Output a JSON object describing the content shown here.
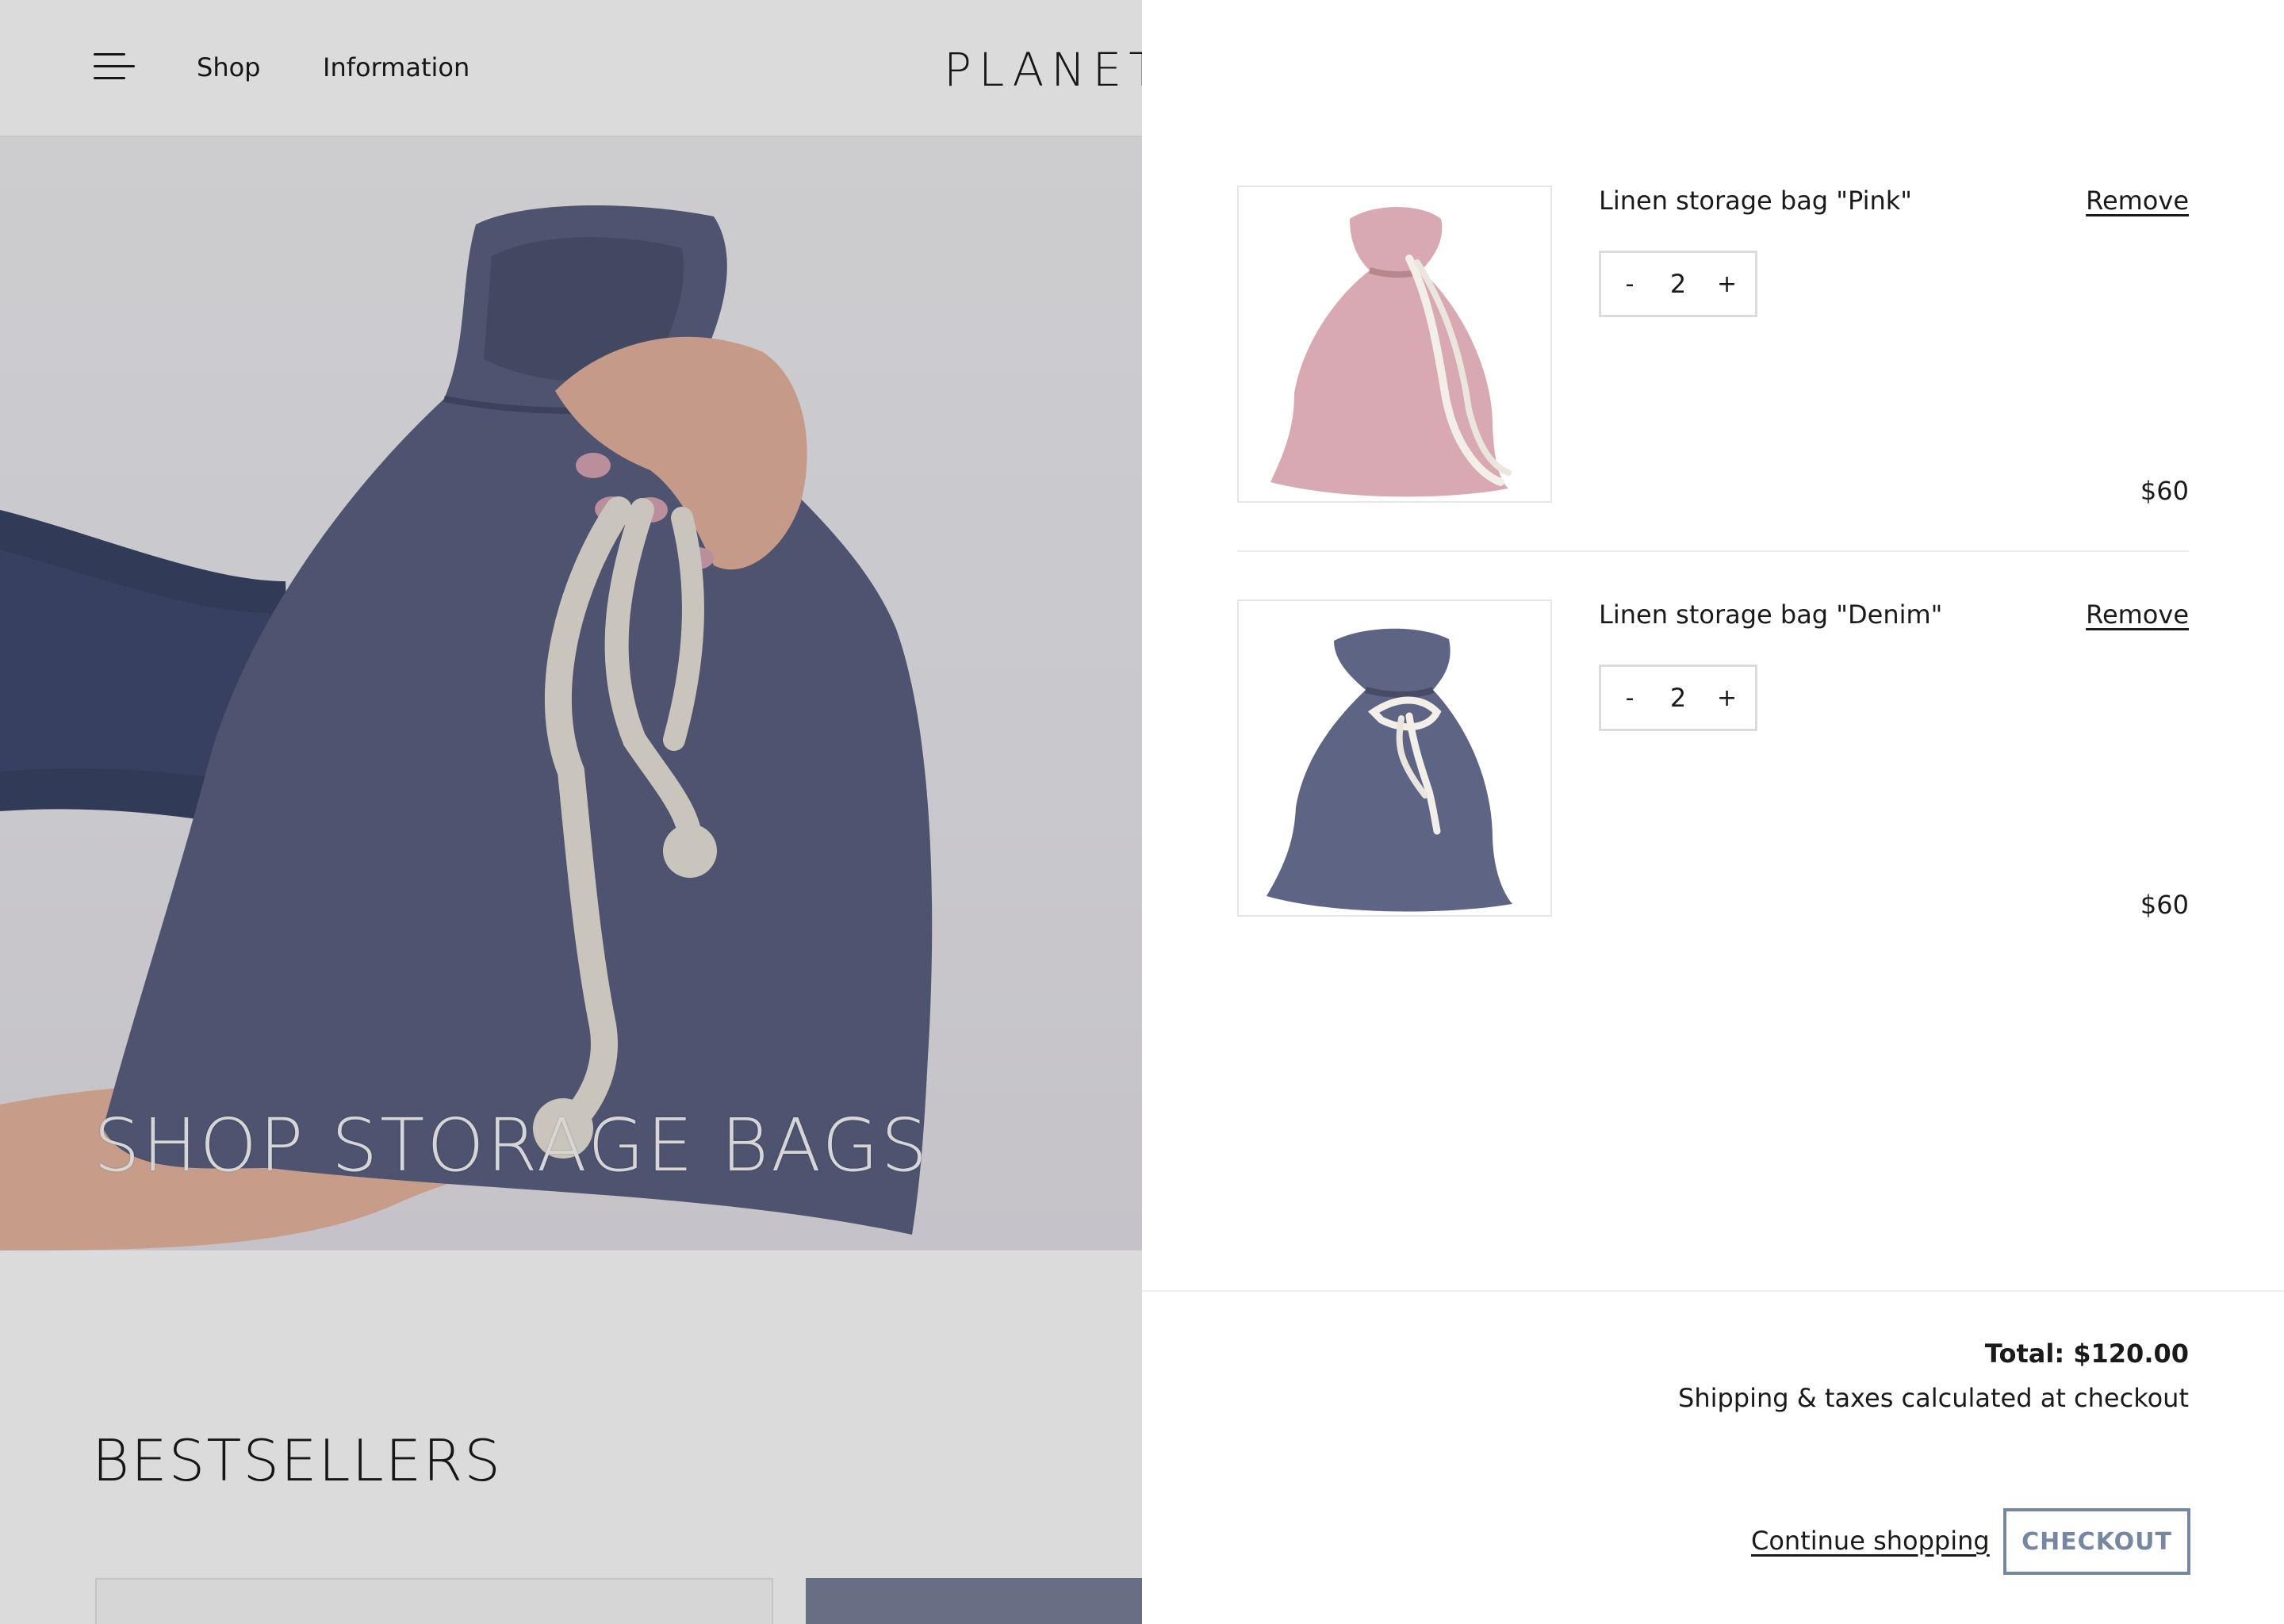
{
  "header": {
    "nav": {
      "shop": "Shop",
      "information": "Information"
    },
    "logo": "PLANET"
  },
  "hero": {
    "title": "SHOP STORAGE BAGS"
  },
  "bestsellers": {
    "title": "BESTSELLERS"
  },
  "cart": {
    "items": [
      {
        "name": "Linen storage bag \"Pink\"",
        "remove_label": "Remove",
        "quantity": "2",
        "decrement": "-",
        "increment": "+",
        "price": "$60",
        "bag_color": "#d9a9b3"
      },
      {
        "name": "Linen storage bag \"Denim\"",
        "remove_label": "Remove",
        "quantity": "2",
        "decrement": "-",
        "increment": "+",
        "price": "$60",
        "bag_color": "#5e6584"
      }
    ],
    "total": "Total: $120.00",
    "shipping_note": "Shipping & taxes calculated at checkout",
    "continue_label": "Continue shopping",
    "checkout_label": "CHECKOUT",
    "accent_color": "#7587a1"
  }
}
